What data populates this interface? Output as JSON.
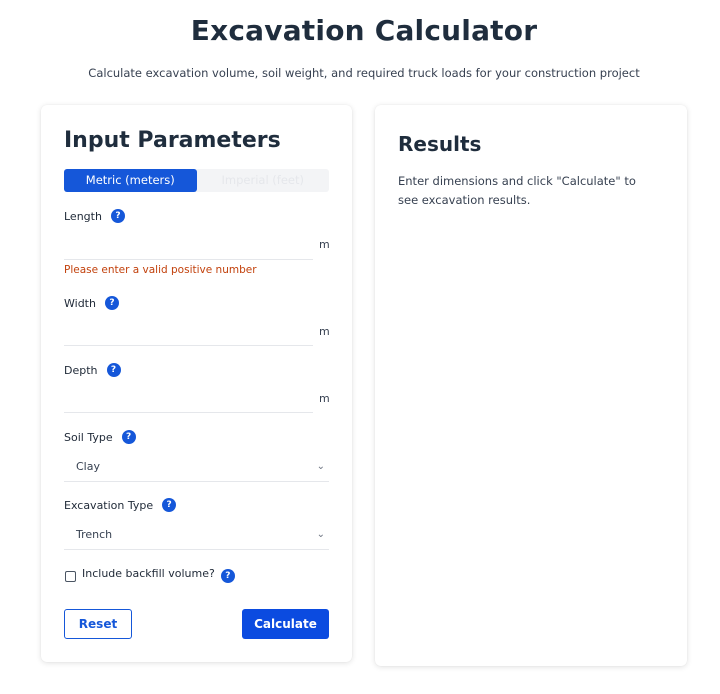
{
  "header": {
    "title": "Excavation Calculator",
    "subtitle": "Calculate excavation volume, soil weight, and required truck loads for your construction project"
  },
  "input_panel": {
    "heading": "Input Parameters",
    "unit_toggle": {
      "metric_label": "Metric (meters)",
      "imperial_label": "Imperial (feet)",
      "selected": "metric"
    },
    "length": {
      "label": "Length",
      "value": "",
      "unit": "m",
      "error": "Please enter a valid positive number"
    },
    "width": {
      "label": "Width",
      "value": "",
      "unit": "m"
    },
    "depth": {
      "label": "Depth",
      "value": "",
      "unit": "m"
    },
    "soil_type": {
      "label": "Soil Type",
      "selected": "Clay"
    },
    "excavation_type": {
      "label": "Excavation Type",
      "selected": "Trench"
    },
    "backfill": {
      "label": "Include backfill volume?",
      "checked": false
    },
    "buttons": {
      "reset": "Reset",
      "calculate": "Calculate"
    }
  },
  "results_panel": {
    "heading": "Results",
    "placeholder_text": "Enter dimensions and click \"Calculate\" to see excavation results."
  },
  "icons": {
    "help": "question-mark-icon",
    "dropdown": "chevron-down-icon"
  },
  "colors": {
    "accent": "#1557d9",
    "error": "#c2410c"
  }
}
